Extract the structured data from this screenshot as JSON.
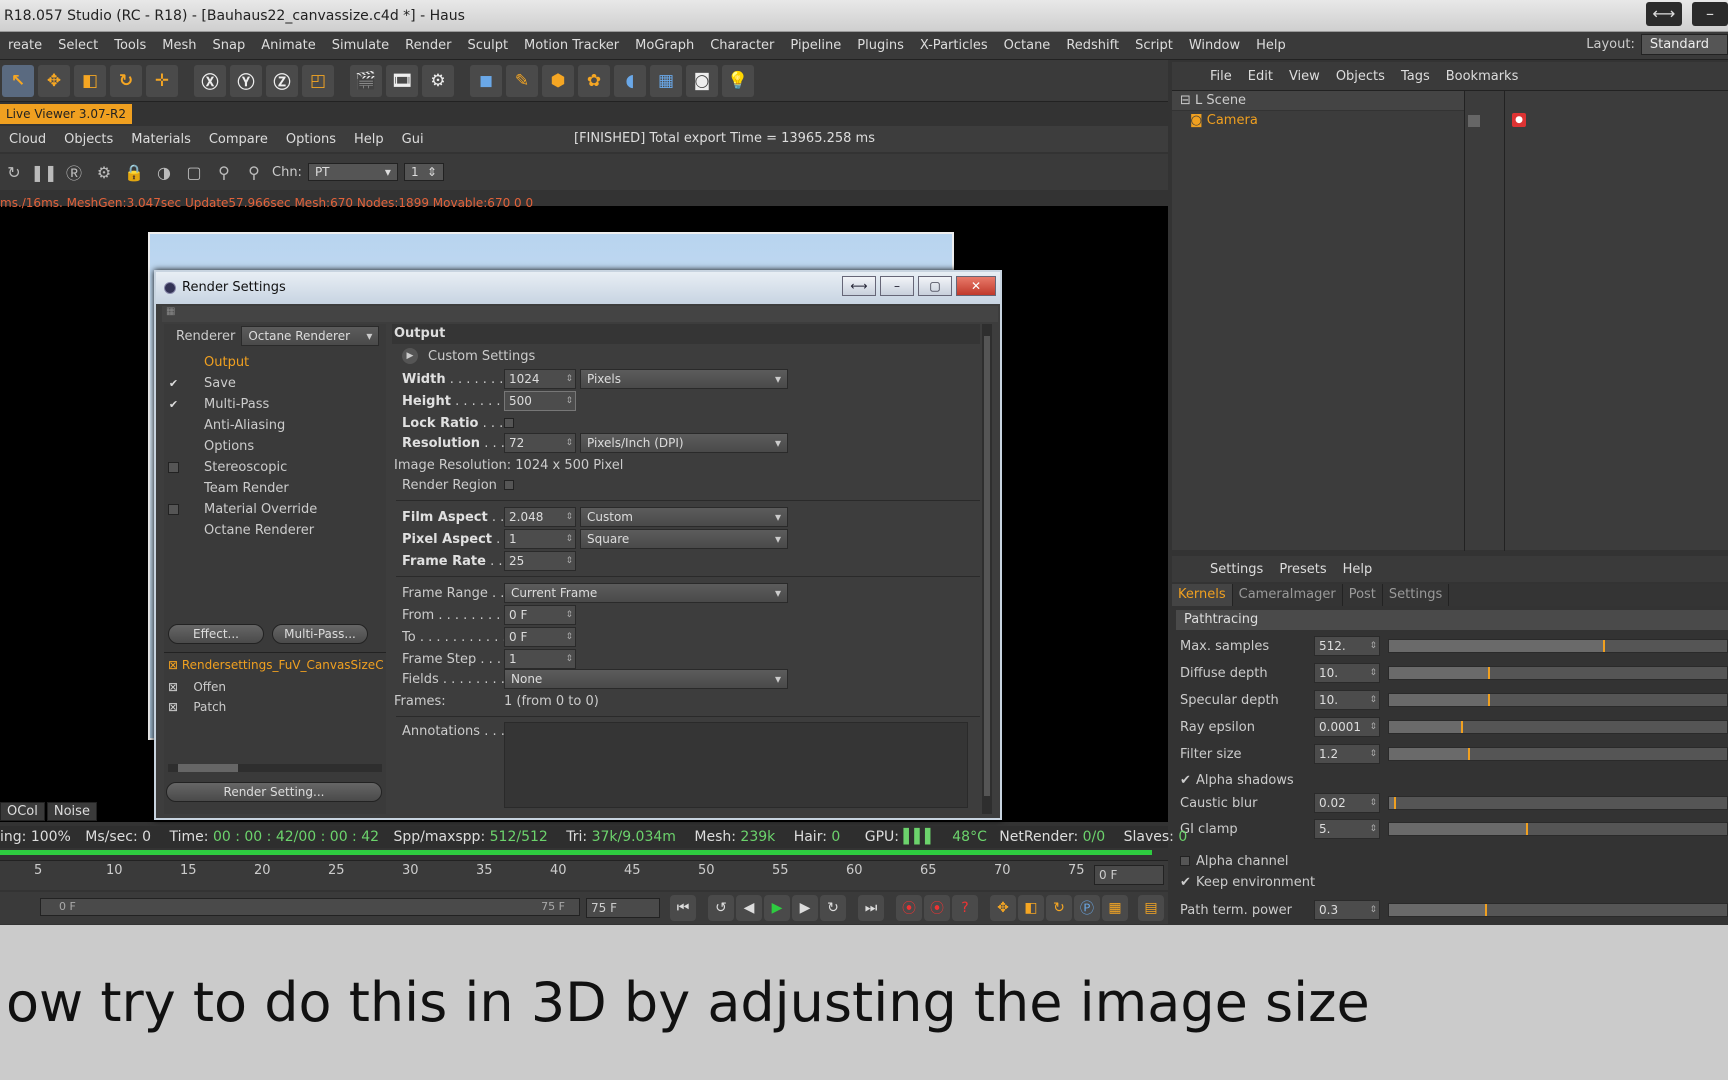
{
  "window": {
    "title": "R18.057 Studio (RC - R18) - [Bauhaus22_canvassize.c4d *] - Haus",
    "ctrl_restore": "⟷",
    "ctrl_min": "–"
  },
  "menu": [
    "reate",
    "Select",
    "Tools",
    "Mesh",
    "Snap",
    "Animate",
    "Simulate",
    "Render",
    "Sculpt",
    "Motion Tracker",
    "MoGraph",
    "Character",
    "Pipeline",
    "Plugins",
    "X-Particles",
    "Octane",
    "Redshift",
    "Script",
    "Window",
    "Help"
  ],
  "layout": {
    "label": "Layout:",
    "value": "Standard"
  },
  "liveviewer": {
    "tab": "Live Viewer 3.07-R2",
    "menu": [
      "Cloud",
      "Objects",
      "Materials",
      "Compare",
      "Options",
      "Help",
      "Gui"
    ],
    "status": "[FINISHED] Total export Time = 13965.258 ms",
    "chn_label": "Chn:",
    "chn_value": "PT",
    "chn_num": "1",
    "info": "ms./16ms. MeshGen:3.047sec Update57.966sec Mesh:670 Nodes:1899 Movable:670  0 0",
    "ocol": "OCol",
    "noise": "Noise"
  },
  "dialog": {
    "title": "Render Settings",
    "renderer_label": "Renderer",
    "renderer_value": "Octane Renderer",
    "tree": [
      {
        "label": "Output",
        "check": "",
        "active": true
      },
      {
        "label": "Save",
        "check": "✔"
      },
      {
        "label": "Multi-Pass",
        "check": "✔"
      },
      {
        "label": "Anti-Aliasing",
        "check": ""
      },
      {
        "label": "Options",
        "check": ""
      },
      {
        "label": "Stereoscopic",
        "check": "box"
      },
      {
        "label": "Team Render",
        "check": ""
      },
      {
        "label": "Material Override",
        "check": "box"
      },
      {
        "label": "Octane Renderer",
        "check": ""
      }
    ],
    "effect_btn": "Effect...",
    "multipass_btn": "Multi-Pass...",
    "presets": [
      "Rendersettings_FuV_CanvasSizeC",
      "Offen",
      "Patch"
    ],
    "render_setting_btn": "Render Setting...",
    "section": "Output",
    "custom_settings": "Custom Settings",
    "width_label": "Width",
    "width_value": "1024",
    "width_unit": "Pixels",
    "height_label": "Height",
    "height_value": "500",
    "lock_ratio": "Lock Ratio",
    "resolution_label": "Resolution",
    "resolution_value": "72",
    "resolution_unit": "Pixels/Inch (DPI)",
    "image_resolution": "Image Resolution: 1024 x 500 Pixel",
    "render_region": "Render Region",
    "film_aspect_label": "Film Aspect",
    "film_aspect_value": "2.048",
    "film_aspect_sel": "Custom",
    "pixel_aspect_label": "Pixel Aspect",
    "pixel_aspect_value": "1",
    "pixel_aspect_sel": "Square",
    "frame_rate_label": "Frame Rate",
    "frame_rate_value": "25",
    "frame_range_label": "Frame Range",
    "frame_range_value": "Current Frame",
    "from_label": "From",
    "from_value": "0 F",
    "to_label": "To",
    "to_value": "0 F",
    "frame_step_label": "Frame Step",
    "frame_step_value": "1",
    "fields_label": "Fields",
    "fields_value": "None",
    "frames_label": "Frames:",
    "frames_value": "1 (from 0 to 0)",
    "annotations_label": "Annotations"
  },
  "objmgr": {
    "menu": [
      "File",
      "Edit",
      "View",
      "Objects",
      "Tags",
      "Bookmarks"
    ],
    "items": [
      "Scene",
      "Camera"
    ]
  },
  "attr": {
    "menu": [
      "Settings",
      "Presets",
      "Help"
    ],
    "tabs": [
      "Kernels",
      "CameraImager",
      "Post",
      "Settings"
    ],
    "group": "Pathtracing",
    "rows": [
      {
        "label": "Max. samples",
        "value": "512.",
        "fill": 0.64
      },
      {
        "label": "Diffuse depth",
        "value": "10.",
        "fill": 0.3
      },
      {
        "label": "Specular depth",
        "value": "10.",
        "fill": 0.3
      },
      {
        "label": "Ray epsilon",
        "value": "0.0001",
        "fill": 0.22
      },
      {
        "label": "Filter size",
        "value": "1.2",
        "fill": 0.24
      },
      {
        "label": "Caustic blur",
        "value": "0.02",
        "fill": 0.02
      },
      {
        "label": "GI clamp",
        "value": "5.",
        "fill": 0.41
      },
      {
        "label": "Path term. power",
        "value": "0.3",
        "fill": 0.29
      }
    ],
    "alpha_shadows": "Alpha shadows",
    "alpha_channel": "Alpha channel",
    "keep_env": "Keep environment"
  },
  "status": {
    "sampling": "ing: 100%",
    "mssec": "Ms/sec: 0",
    "time_label": "Time:",
    "time": "00 : 00 : 42/00 : 00 : 42",
    "spp_label": "Spp/maxspp:",
    "spp": "512/512",
    "tri_label": "Tri:",
    "tri": "37k/9.034m",
    "mesh_label": "Mesh:",
    "mesh": "239k",
    "hair_label": "Hair:",
    "hair": "0",
    "gpu_label": "GPU:",
    "temp": "48°C",
    "net_label": "NetRender:",
    "net": "0/0",
    "slaves_label": "Slaves:",
    "slaves": "0"
  },
  "timeline": {
    "ticks": [
      "5",
      "10",
      "15",
      "20",
      "25",
      "30",
      "35",
      "40",
      "45",
      "50",
      "55",
      "60",
      "65",
      "70",
      "75"
    ],
    "frame": "0 F",
    "start": "0 F",
    "end": "75 F",
    "end2": "75 F"
  },
  "caption": "ow try to do this in 3D by adjusting the image size"
}
